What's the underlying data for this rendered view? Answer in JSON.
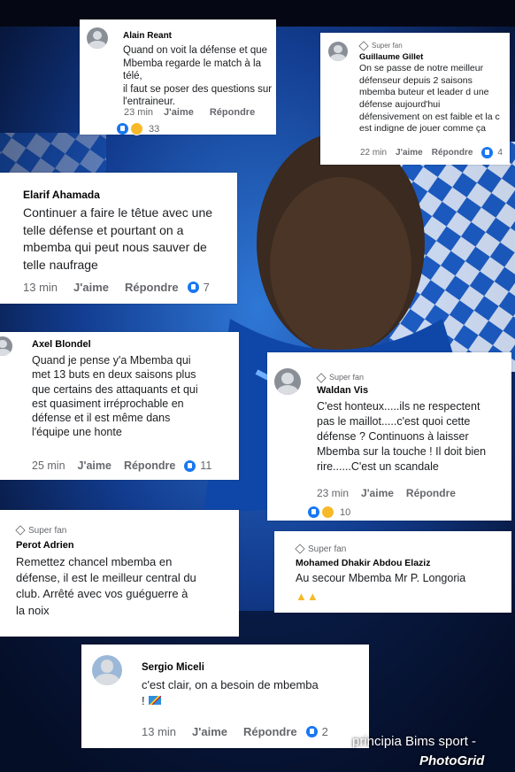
{
  "comments": [
    {
      "id": "c1",
      "name": "Alain Reant",
      "badge": "",
      "lines": [
        "Quand on voit la défense et que",
        "Mbemba regarde le match à la télé,",
        "il faut se poser des questions sur",
        "l'entraineur."
      ],
      "time": "23 min",
      "like": "J'aime",
      "reply": "Répondre",
      "count": "",
      "reactions": "33"
    },
    {
      "id": "c2",
      "name": "Guillaume Gillet",
      "badge": "Super fan",
      "lines": [
        "On se passe de notre meilleur",
        "défenseur depuis 2 saisons",
        "mbemba buteur et leader d une",
        "défense aujourd'hui",
        "défensivement on est faible et la c",
        "est indigne de jouer comme ça"
      ],
      "time": "22 min",
      "like": "J'aime",
      "reply": "Répondre",
      "count": "4",
      "reactions": ""
    },
    {
      "id": "c3",
      "name": "Elarif Ahamada",
      "badge": "",
      "lines": [
        "Continuer a faire le têtue avec une",
        "telle défense et pourtant on a",
        "mbemba qui peut nous sauver de",
        "telle naufrage"
      ],
      "time": "13 min",
      "like": "J'aime",
      "reply": "Répondre",
      "count": "7",
      "reactions": ""
    },
    {
      "id": "c4",
      "name": "Axel Blondel",
      "badge": "",
      "lines": [
        "Quand je pense y'a Mbemba qui",
        "met 13 buts en deux saisons plus",
        "que certains des attaquants et qui",
        "est quasiment irréprochable en",
        "défense et il est même dans",
        "l'équipe une honte"
      ],
      "time": "25 min",
      "like": "J'aime",
      "reply": "Répondre",
      "count": "11",
      "reactions": ""
    },
    {
      "id": "c5",
      "name": "Waldan Vis",
      "badge": "Super fan",
      "lines": [
        "C'est honteux.....ils ne respectent",
        "pas le maillot.....c'est quoi cette",
        "défense ? Continuons à laisser",
        "Mbemba sur la touche ! Il doit bien",
        "rire......C'est un scandale"
      ],
      "time": "23 min",
      "like": "J'aime",
      "reply": "Répondre",
      "count": "",
      "reactions": "10"
    },
    {
      "id": "c6",
      "name": "Perot Adrien",
      "badge": "Super fan",
      "lines": [
        "Remettez chancel mbemba en",
        "défense, il est le meilleur central du",
        "club. Arrêté avec vos guéguerre à",
        "la noix"
      ],
      "time": "",
      "like": "",
      "reply": "",
      "count": "",
      "reactions": ""
    },
    {
      "id": "c7",
      "name": "Mohamed Dhakir Abdou Elaziz",
      "badge": "Super fan",
      "lines": [
        "Au secour Mbemba Mr P. Longoria"
      ],
      "time": "",
      "like": "",
      "reply": "",
      "count": "",
      "reactions": ""
    },
    {
      "id": "c8",
      "name": "Sergio Miceli",
      "badge": "",
      "lines": [
        "c'est clair, on a besoin de mbemba",
        "!"
      ],
      "time": "13 min",
      "like": "J'aime",
      "reply": "Répondre",
      "count": "2",
      "reactions": ""
    }
  ],
  "watermark": "principia Bims sport -",
  "photogrid": "PhotoGrid",
  "colors": {
    "like": "#1877f2",
    "meta": "#65676b",
    "card": "#ffffff",
    "background": "#0d2a6b"
  }
}
